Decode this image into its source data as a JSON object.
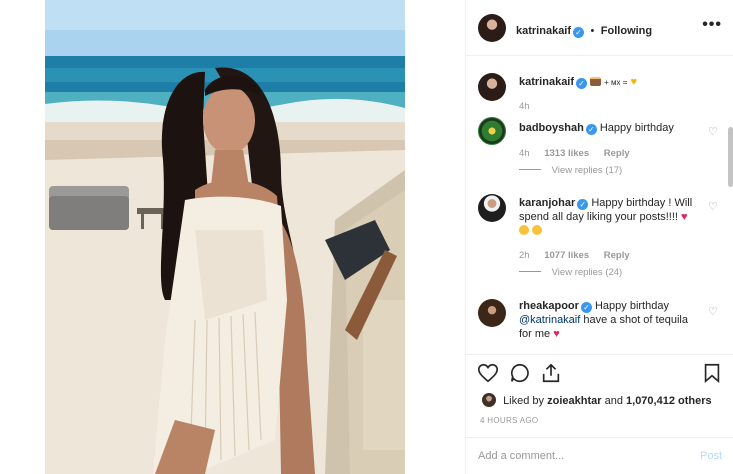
{
  "post": {
    "author": "katrinakaif",
    "separator": "•",
    "follow_status": "Following",
    "more_icon": "more-icon",
    "verified_icon": "verified-badge-icon"
  },
  "caption": {
    "username": "katrinakaif",
    "text_mx": "+ мх =",
    "time": "4h"
  },
  "comments": [
    {
      "username": "badboyshah",
      "text": "Happy birthday",
      "time": "4h",
      "likes": "1313 likes",
      "reply": "Reply",
      "view_replies": "View replies (17)"
    },
    {
      "username": "karanjohar",
      "text": "Happy birthday ! Will spend all day liking your posts!!!!",
      "time": "2h",
      "likes": "1077 likes",
      "reply": "Reply",
      "view_replies": "View replies (24)"
    },
    {
      "username": "rheakapoor",
      "text_before": "Happy birthday",
      "mention": "@katrinakaif",
      "text_after": "have a shot of tequila for me"
    }
  ],
  "actions": {
    "icons": [
      "heart-icon",
      "comment-icon",
      "share-icon",
      "bookmark-icon"
    ]
  },
  "likes": {
    "prefix": "Liked by",
    "user": "zoieakhtar",
    "middle": "and",
    "count": "1,070,412 others"
  },
  "timestamp": "4 HOURS AGO",
  "add_comment": {
    "placeholder": "Add a comment...",
    "post_label": "Post"
  },
  "colors": {
    "verified": "#3897f0",
    "link_disabled": "#b3dbff",
    "secondary_text": "#999999",
    "heart_red": "#e0245e"
  }
}
